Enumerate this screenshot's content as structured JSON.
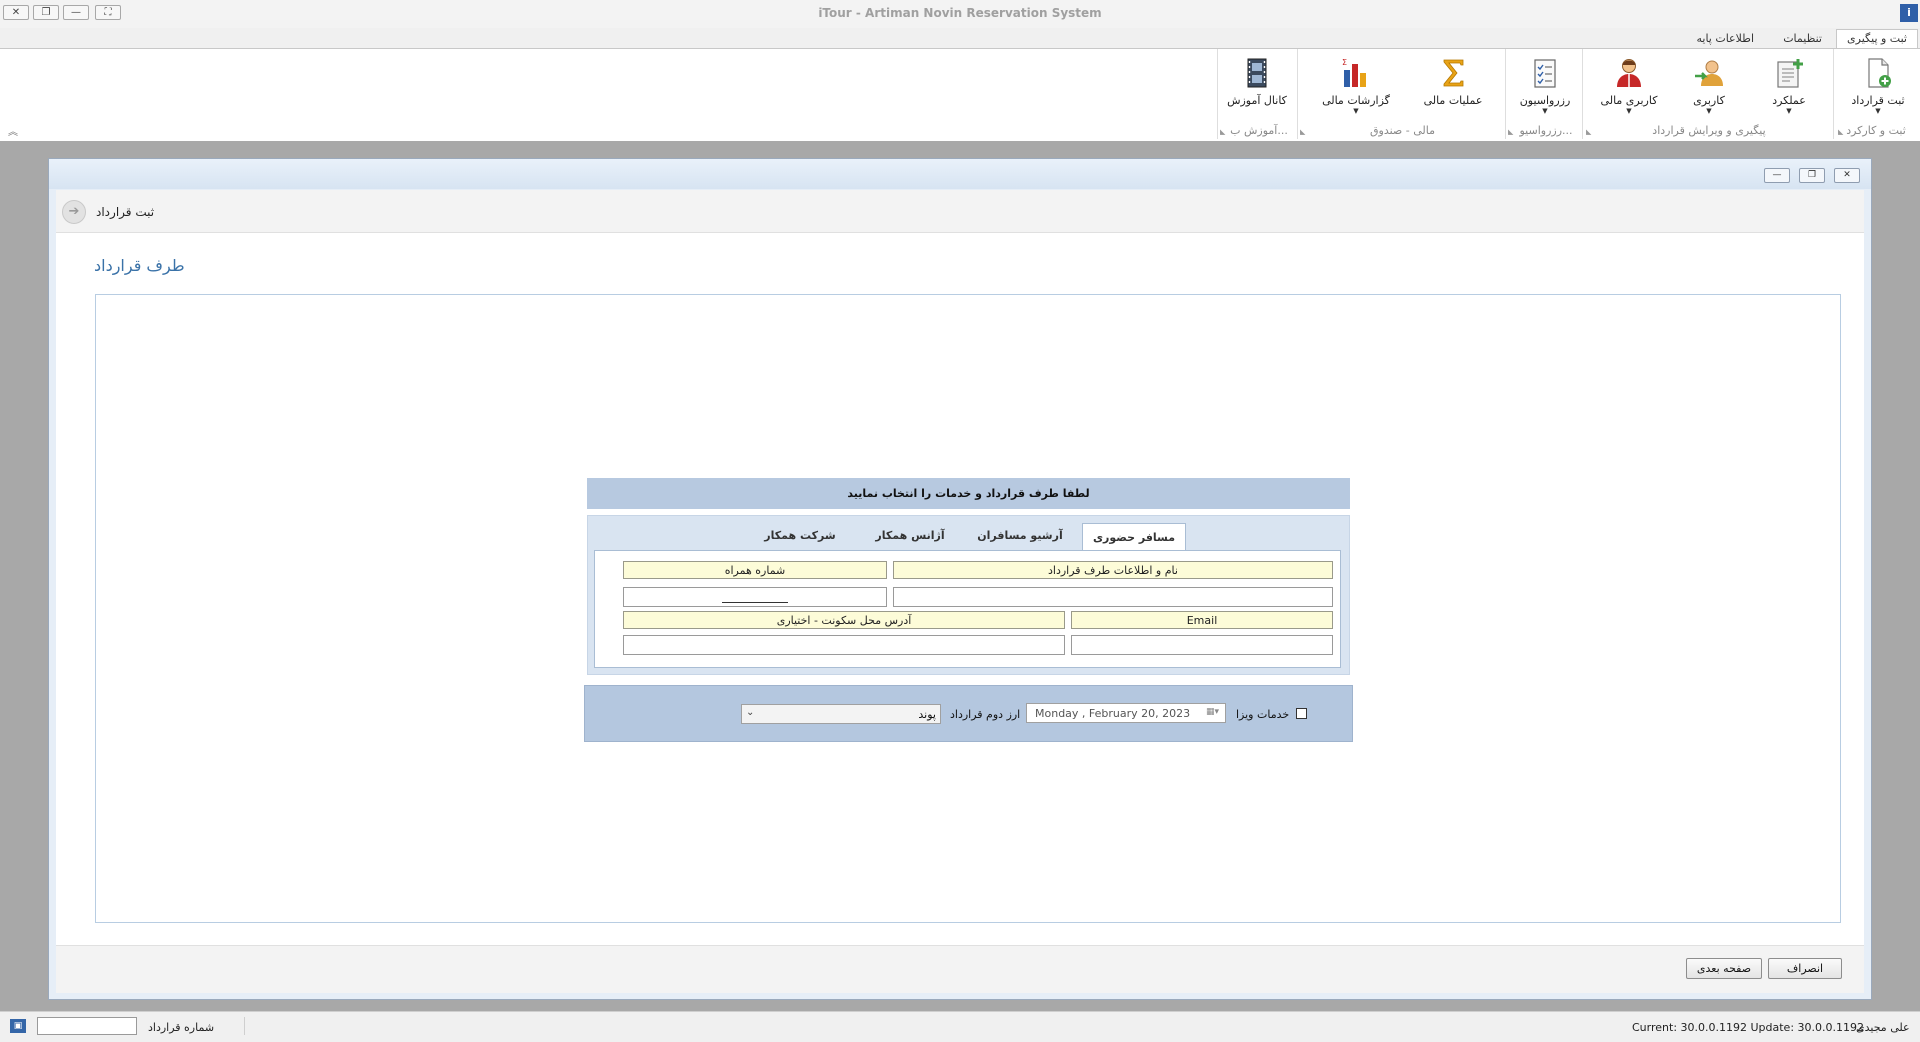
{
  "window": {
    "title": "iTour - Artiman Novin Reservation System",
    "controls": {
      "close": "✕",
      "restore": "❐",
      "minimize": "—",
      "maximize": "⛶"
    },
    "app_icon": "i"
  },
  "ribbon": {
    "tabs": [
      {
        "label": "ثبت و پیگیری",
        "active": true
      },
      {
        "label": "تنظیمات",
        "active": false
      },
      {
        "label": "اطلاعات پایه",
        "active": false
      }
    ],
    "buttons": {
      "register_contract": "ثبت قرارداد",
      "performance": "عملکرد",
      "user": "کاربری",
      "financial_user": "کاربری مالی",
      "reservation": "رزرواسیون",
      "financial_ops": "عملیات مالی",
      "financial_reports": "گزارشات مالی",
      "training_channel": "کانال آموزش"
    },
    "groups": {
      "register_work": "ثبت و کارکرد",
      "followup_edit": "پیگیری و ویرایش قرارداد",
      "reservation": "رزرواسیو...",
      "finance_cash": "مالی - صندوق",
      "training": "آموزش ب..."
    },
    "icons": {
      "register_contract": "add-document-icon",
      "performance": "add-report-icon",
      "user": "add-user-icon",
      "financial_user": "financial-user-icon",
      "reservation": "checklist-icon",
      "financial_ops": "sigma-icon",
      "financial_reports": "bar-chart-icon",
      "training_channel": "film-icon"
    }
  },
  "form": {
    "header_title": "ثبت قرارداد",
    "section_title": "طرف قرارداد",
    "prompt": "لطفا طرف قرارداد و خدمات را انتخاب نمایید",
    "tabs": [
      {
        "label": "مسافر حضوری",
        "active": true
      },
      {
        "label": "آرشیو مسافران",
        "active": false
      },
      {
        "label": "آژانس همکار",
        "active": false
      },
      {
        "label": "شرکت همکار",
        "active": false
      }
    ],
    "fields": {
      "name_label": "نام و اطلاعات طرف قرارداد",
      "phone_label": "شماره همراه",
      "email_label": "Email",
      "address_label": "آدرس محل سکونت - اختیاری",
      "name_value": "",
      "phone_value": "",
      "email_value": "",
      "address_value": ""
    },
    "options": {
      "visa_label": "خدمات ویزا",
      "visa_checked": false,
      "date_value": "Monday   ,  February  20, 2023",
      "second_currency_label": "ارز دوم قرارداد",
      "second_currency_value": "پوند"
    },
    "buttons": {
      "cancel": "انصراف",
      "next": "صفحه بعدی"
    }
  },
  "statusbar": {
    "contract_number_label": "شماره قرارداد",
    "contract_number_value": "",
    "version": "Current: 30.0.0.1192 Update: 30.0.0.1192",
    "user": "علی مجیدی"
  },
  "colors": {
    "accent_blue": "#3a72a8",
    "panel_blue": "#b7c9e0",
    "label_yellow": "#fdfcd8"
  }
}
